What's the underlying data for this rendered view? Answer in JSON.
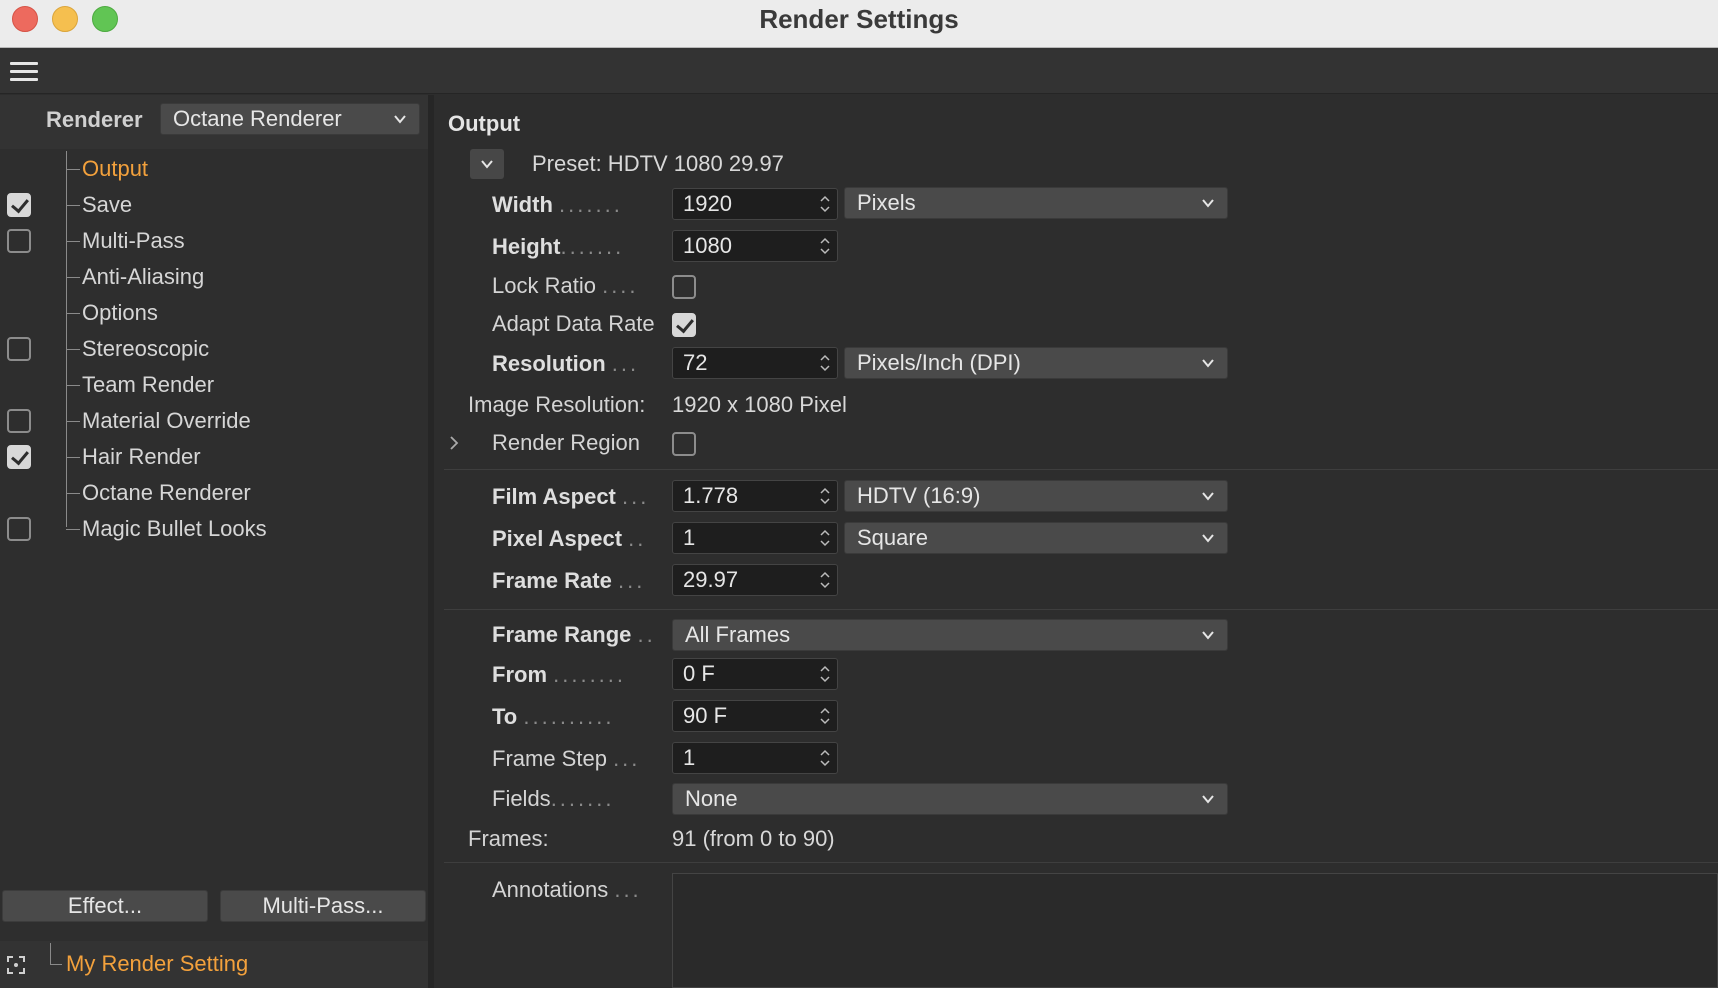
{
  "window": {
    "title": "Render Settings"
  },
  "renderer": {
    "label": "Renderer",
    "value": "Octane Renderer"
  },
  "tree": {
    "items": [
      {
        "label": "Output",
        "active": true,
        "checkbox": null
      },
      {
        "label": "Save",
        "active": false,
        "checkbox": "checked"
      },
      {
        "label": "Multi-Pass",
        "active": false,
        "checkbox": "unchecked"
      },
      {
        "label": "Anti-Aliasing",
        "active": false,
        "checkbox": null
      },
      {
        "label": "Options",
        "active": false,
        "checkbox": null
      },
      {
        "label": "Stereoscopic",
        "active": false,
        "checkbox": "unchecked"
      },
      {
        "label": "Team Render",
        "active": false,
        "checkbox": null
      },
      {
        "label": "Material Override",
        "active": false,
        "checkbox": "unchecked"
      },
      {
        "label": "Hair Render",
        "active": false,
        "checkbox": "checked"
      },
      {
        "label": "Octane Renderer",
        "active": false,
        "checkbox": null
      },
      {
        "label": "Magic Bullet Looks",
        "active": false,
        "checkbox": "unchecked"
      }
    ]
  },
  "buttons": {
    "effect": "Effect...",
    "multipass": "Multi-Pass..."
  },
  "render_setting": {
    "name": "My Render Setting"
  },
  "output": {
    "title": "Output",
    "preset": "Preset: HDTV 1080 29.97",
    "width": {
      "label": "Width",
      "value": "1920",
      "unit": "Pixels"
    },
    "height": {
      "label": "Height",
      "value": "1080"
    },
    "lock_ratio": {
      "label": "Lock Ratio",
      "checked": false
    },
    "adapt_data_rate": {
      "label": "Adapt Data Rate",
      "checked": true
    },
    "resolution": {
      "label": "Resolution",
      "value": "72",
      "unit": "Pixels/Inch (DPI)"
    },
    "image_resolution": {
      "label": "Image Resolution:",
      "value": "1920 x 1080 Pixel"
    },
    "render_region": {
      "label": "Render Region",
      "checked": false
    },
    "film_aspect": {
      "label": "Film Aspect",
      "value": "1.778",
      "preset": "HDTV (16:9)"
    },
    "pixel_aspect": {
      "label": "Pixel Aspect",
      "value": "1",
      "preset": "Square"
    },
    "frame_rate": {
      "label": "Frame Rate",
      "value": "29.97"
    },
    "frame_range": {
      "label": "Frame Range",
      "value": "All Frames"
    },
    "from": {
      "label": "From",
      "value": "0 F"
    },
    "to": {
      "label": "To",
      "value": "90 F"
    },
    "frame_step": {
      "label": "Frame Step",
      "value": "1"
    },
    "fields": {
      "label": "Fields",
      "value": "None"
    },
    "frames": {
      "label": "Frames:",
      "value": "91 (from 0 to 90)"
    },
    "annotations": {
      "label": "Annotations"
    }
  }
}
